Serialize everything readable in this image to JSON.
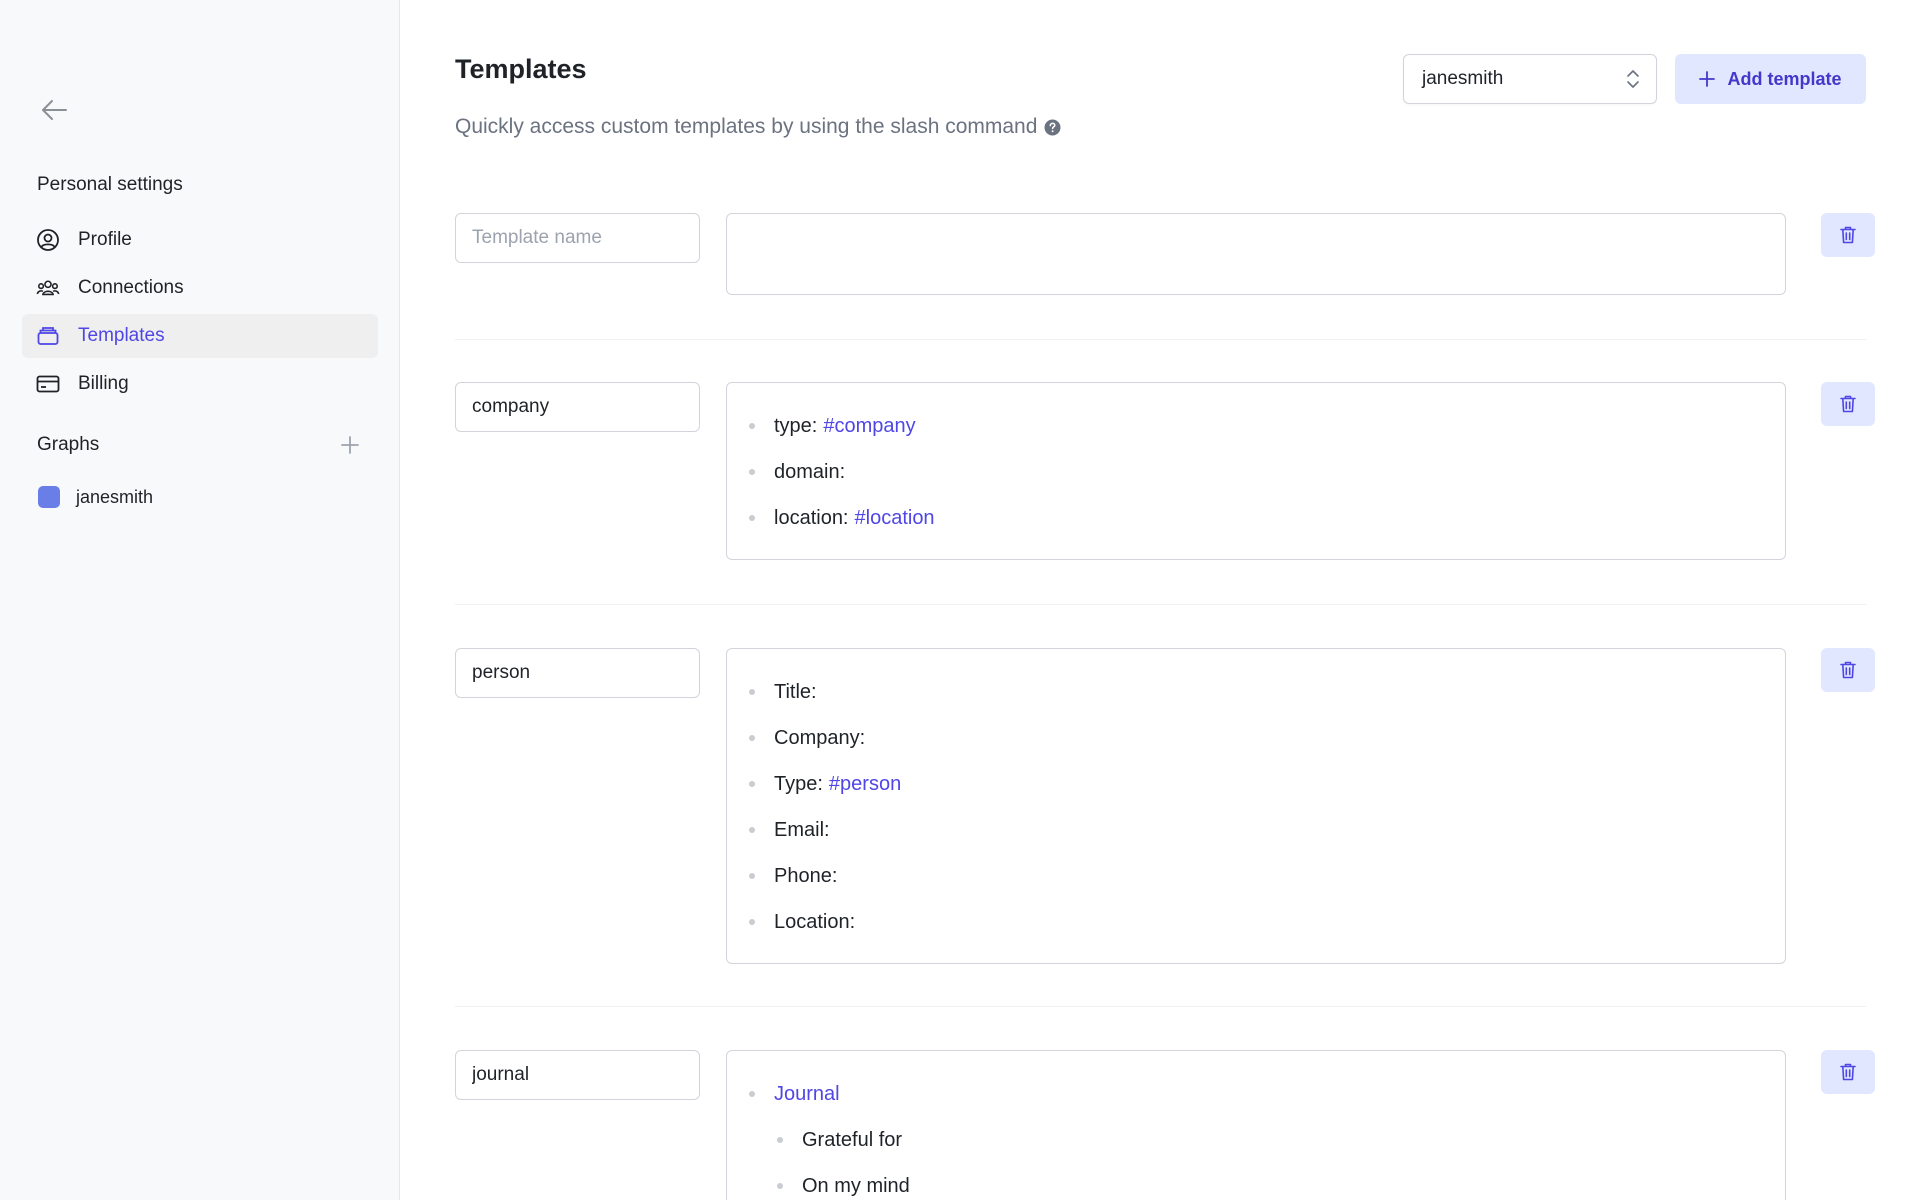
{
  "sidebar": {
    "section_title": "Personal settings",
    "nav": [
      {
        "label": "Profile",
        "icon": "user-circle-icon",
        "active": false
      },
      {
        "label": "Connections",
        "icon": "users-icon",
        "active": false
      },
      {
        "label": "Templates",
        "icon": "stack-icon",
        "active": true
      },
      {
        "label": "Billing",
        "icon": "credit-card-icon",
        "active": false
      }
    ],
    "graphs_title": "Graphs",
    "graphs": [
      {
        "label": "janesmith",
        "color": "#6a7ee8"
      }
    ]
  },
  "header": {
    "title": "Templates",
    "subtitle": "Quickly access custom templates by using the slash command",
    "graph_select_value": "janesmith",
    "add_button_label": "Add template"
  },
  "templates": [
    {
      "name": "",
      "name_placeholder": "Template name",
      "lines": []
    },
    {
      "name": "company",
      "name_placeholder": "Template name",
      "lines": [
        {
          "text": "type:",
          "tag": "#company"
        },
        {
          "text": "domain:",
          "tag": ""
        },
        {
          "text": "location:",
          "tag": "#location"
        }
      ]
    },
    {
      "name": "person",
      "name_placeholder": "Template name",
      "lines": [
        {
          "text": "Title:",
          "tag": ""
        },
        {
          "text": "Company:",
          "tag": ""
        },
        {
          "text": "Type:",
          "tag": "#person"
        },
        {
          "text": "Email:",
          "tag": ""
        },
        {
          "text": "Phone:",
          "tag": ""
        },
        {
          "text": "Location:",
          "tag": ""
        }
      ]
    },
    {
      "name": "journal",
      "name_placeholder": "Template name",
      "lines": [
        {
          "link": "Journal"
        },
        {
          "text": "Grateful for",
          "indent": true
        },
        {
          "text": "On my mind",
          "indent": true
        }
      ]
    }
  ],
  "colors": {
    "accent": "#4f46e5",
    "accent_bg": "#e0e7ff",
    "sidebar_bg": "#f8f9fa"
  }
}
